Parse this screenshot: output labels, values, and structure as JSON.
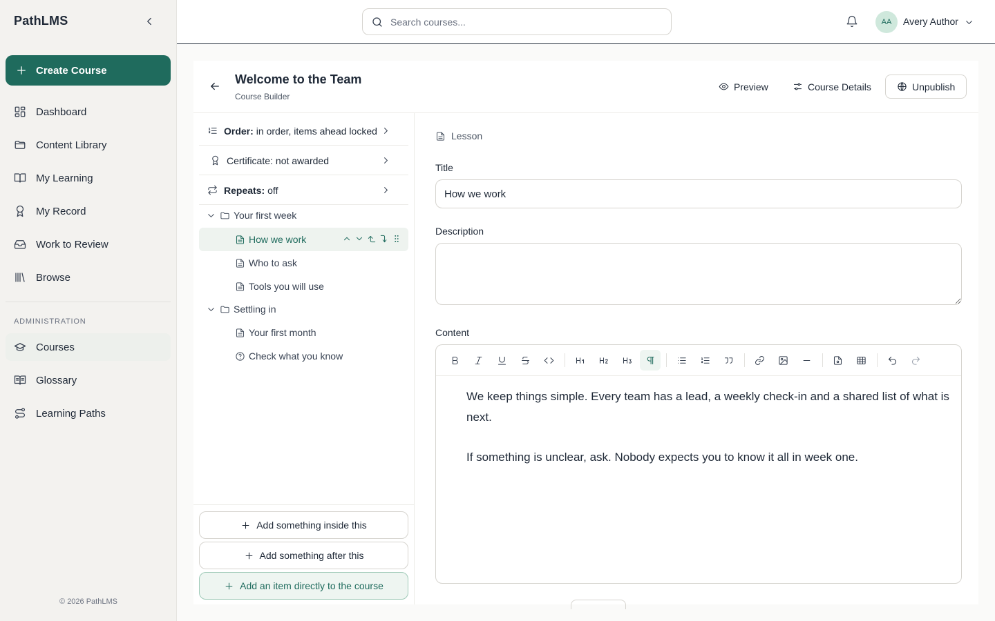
{
  "sidebar": {
    "brand": "PathLMS",
    "create_label": "Create Course",
    "items": [
      {
        "label": "Dashboard",
        "icon": "dashboard-icon"
      },
      {
        "label": "Content Library",
        "icon": "folder-icon"
      },
      {
        "label": "My Learning",
        "icon": "book-open-icon"
      },
      {
        "label": "My Record",
        "icon": "award-icon"
      },
      {
        "label": "Work to Review",
        "icon": "inbox-icon"
      },
      {
        "label": "Browse",
        "icon": "library-icon"
      }
    ],
    "admin_label": "ADMINISTRATION",
    "admin_items": [
      {
        "label": "Courses",
        "icon": "graduation-cap-icon",
        "active": true
      },
      {
        "label": "Glossary",
        "icon": "book-text-icon"
      },
      {
        "label": "Learning Paths",
        "icon": "route-icon"
      }
    ],
    "copyright": "© 2026 PathLMS"
  },
  "topbar": {
    "search_placeholder": "Search courses...",
    "avatar_initials": "AA",
    "user_name": "Avery Author"
  },
  "header": {
    "title": "Welcome to the Team",
    "subtitle": "Course Builder",
    "preview_label": "Preview",
    "details_label": "Course Details",
    "unpublish_label": "Unpublish"
  },
  "outline": {
    "order": {
      "key": "Order:",
      "value": "in order, items ahead locked"
    },
    "certificate": {
      "key": "Certificate:",
      "value": "not awarded"
    },
    "repeats": {
      "key": "Repeats:",
      "value": "off"
    },
    "tree": [
      {
        "type": "folder",
        "label": "Your first week"
      },
      {
        "type": "lesson",
        "label": "How we work",
        "selected": true
      },
      {
        "type": "lesson",
        "label": "Who to ask"
      },
      {
        "type": "lesson",
        "label": "Tools you will use"
      },
      {
        "type": "folder",
        "label": "Settling in"
      },
      {
        "type": "lesson",
        "label": "Your first month"
      },
      {
        "type": "quiz",
        "label": "Check what you know"
      }
    ],
    "add_inside": "Add something inside this",
    "add_after": "Add something after this",
    "add_course": "Add an item directly to the course"
  },
  "editor": {
    "type_label": "Lesson",
    "title_label": "Title",
    "title_value": "How we work",
    "description_label": "Description",
    "description_value": "",
    "content_label": "Content",
    "toolbar": [
      "bold",
      "italic",
      "underline",
      "strikethrough",
      "code",
      "H1",
      "H2",
      "H3",
      "paragraph",
      "bullet-list",
      "ordered-list",
      "quote",
      "link",
      "image",
      "horizontal-rule",
      "file",
      "table",
      "undo",
      "redo"
    ],
    "paragraphs": [
      "We keep things simple. Every team has a lead, a weekly check-in and a shared list of what is next.",
      "If something is unclear, ask. Nobody expects you to know it all in week one."
    ]
  },
  "colors": {
    "accent": "#1f6b5d",
    "accent_light": "#eef5f1",
    "sidebar_bg": "#f3f2ef"
  }
}
